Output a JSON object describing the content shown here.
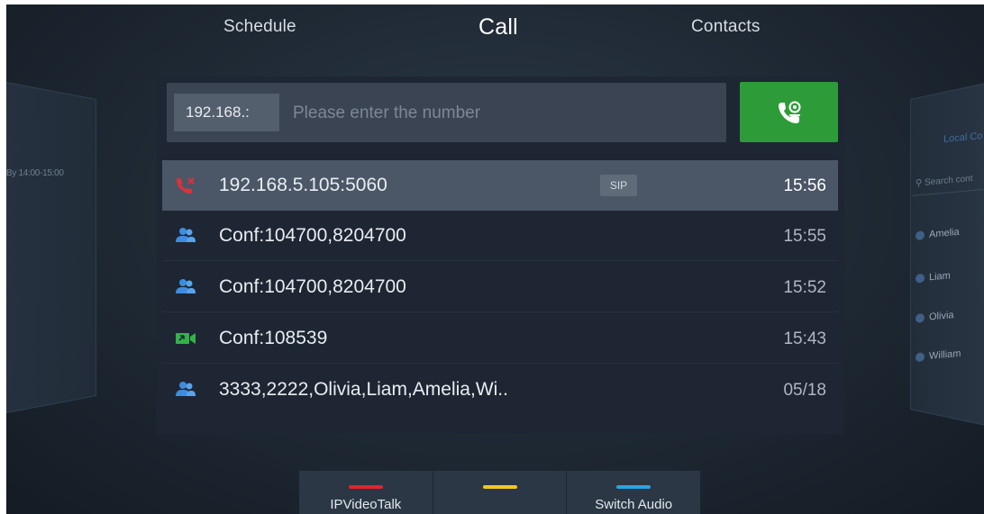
{
  "tabs": [
    {
      "label": "Schedule"
    },
    {
      "label": "Call"
    },
    {
      "label": "Contacts"
    }
  ],
  "left_panel": {
    "text": "By 14:00-15:00"
  },
  "right_panel": {
    "title": "Local Co",
    "search_placeholder": "Search cont",
    "contacts": [
      "Amelia",
      "Liam",
      "Olivia",
      "William"
    ]
  },
  "dial": {
    "prefix_value": "192.168.:",
    "placeholder": "Please enter the number"
  },
  "history": [
    {
      "icon": "missed-call-icon",
      "label": "192.168.5.105:5060",
      "badge": "SIP",
      "time": "15:56",
      "selected": true
    },
    {
      "icon": "conference-icon",
      "label": "Conf:104700,8204700",
      "badge": "",
      "time": "15:55"
    },
    {
      "icon": "conference-icon",
      "label": "Conf:104700,8204700",
      "badge": "",
      "time": "15:52"
    },
    {
      "icon": "video-call-icon",
      "label": "Conf:108539",
      "badge": "",
      "time": "15:43"
    },
    {
      "icon": "conference-icon",
      "label": "3333,2222,Olivia,Liam,Amelia,Wi..",
      "badge": "",
      "time": "05/18"
    }
  ],
  "softkeys": [
    {
      "label": "IPVideoTalk",
      "color": "#e0252b"
    },
    {
      "label": "",
      "color": "#f0c81c"
    },
    {
      "label": "Switch Audio",
      "color": "#2aa3e3"
    }
  ],
  "colors": {
    "call_button": "#2d9c38",
    "missed_call": "#e0303a",
    "conference": "#3d8de0",
    "video_call": "#33b24a"
  }
}
